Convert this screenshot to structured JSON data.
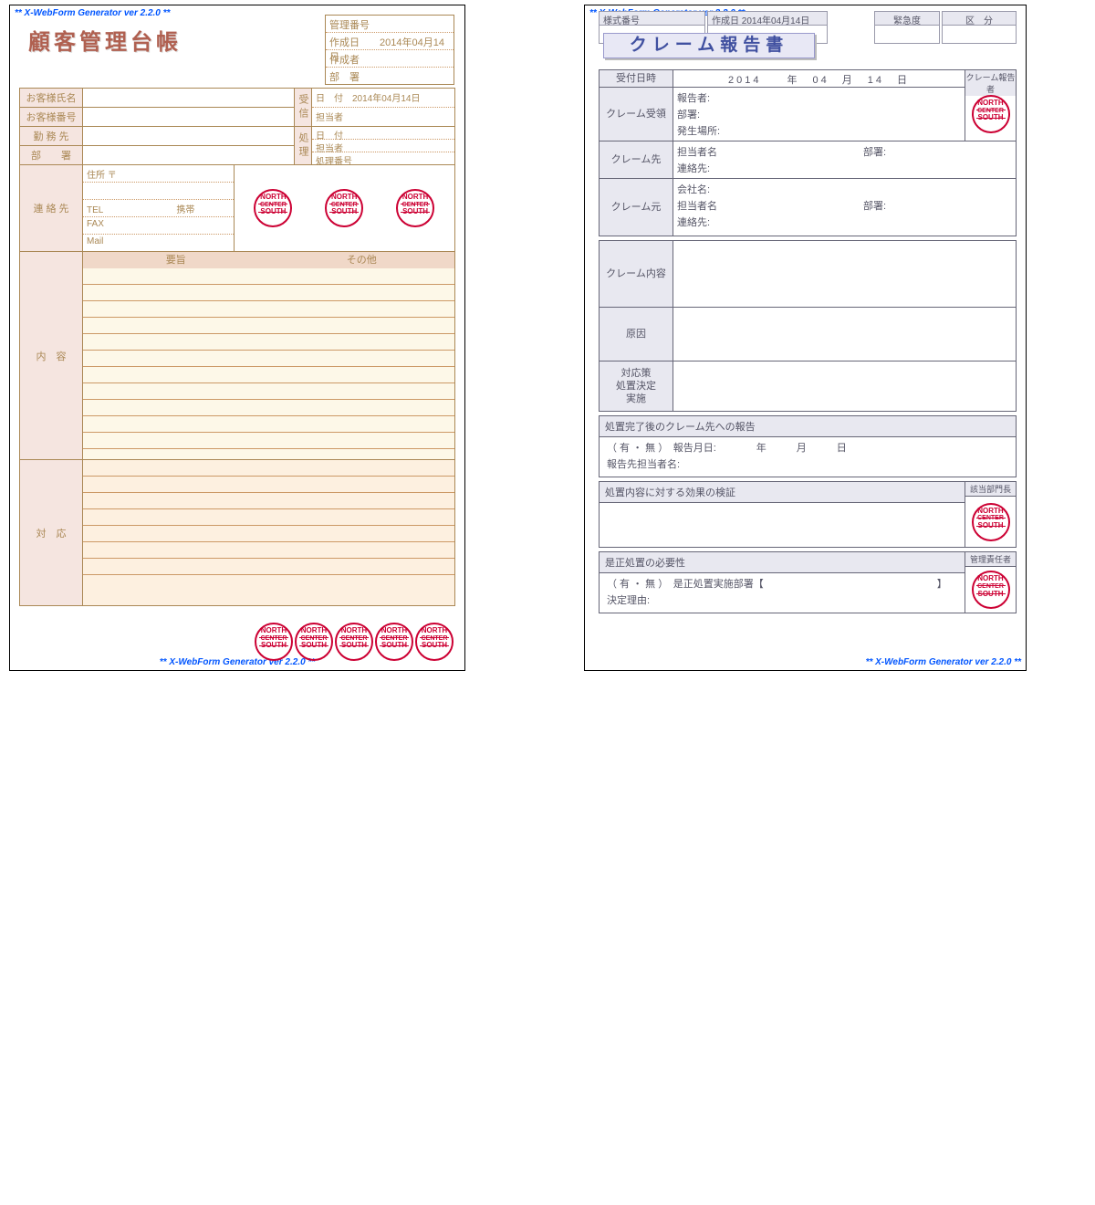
{
  "watermark": "** X-WebForm Generator ver 2.2.0 **",
  "stamp": {
    "top": "NORTH",
    "mid": "CENTER",
    "bot": "SOUTH"
  },
  "form1": {
    "title": "顧客管理台帳",
    "hdr": {
      "manage_no": "管理番号",
      "create_date_l": "作成日",
      "create_date_v": "2014年04月14日",
      "creator": "作成者",
      "dept": "部　署"
    },
    "left": {
      "customer_name": "お客様氏名",
      "customer_no": "お客様番号",
      "work": "勤 務 先",
      "dept": "部　　署",
      "contact": "連 絡 先",
      "address": "住所 〒",
      "tel": "TEL",
      "mobile": "携帯",
      "fax": "FAX",
      "mail": "Mail"
    },
    "right": {
      "receive": "受信",
      "date_l": "日　付",
      "date_v": "2014年04月14日",
      "person": "担当者",
      "process": "処理",
      "date2": "日　付",
      "person2": "担当者",
      "proc_no": "処理番号"
    },
    "content": "内　容",
    "summary": "要旨",
    "other": "その他",
    "response": "対　応"
  },
  "form2": {
    "title": "クレーム報告書",
    "hdr": {
      "form_no": "様式番号",
      "create_date_l": "作成日",
      "create_date_v": "2014年04月14日",
      "urgency": "緊急度",
      "category": "区　分"
    },
    "tbl1": {
      "date_l": "受付日時",
      "date_v": "2014　　年　04　月　14　日",
      "reporter_col": "クレーム報告者",
      "receive": "クレーム受領",
      "reporter": "報告者:",
      "dept_f": "部署:",
      "place": "発生場所:",
      "dest": "クレーム先",
      "person": "担当者名",
      "dept": "部署:",
      "contact": "連絡先:",
      "source": "クレーム元",
      "company": "会社名:"
    },
    "tbl2": {
      "content": "クレーム内容",
      "cause": "原因",
      "measure1": "対応策",
      "measure2": "処置決定",
      "measure3": "実施"
    },
    "report": {
      "hdr": "処置完了後のクレーム先への報告",
      "line1a": "（ 有 ・ 無 ）",
      "line1b": "報告月日:",
      "line1c": "年　　　月　　　日",
      "line2": "報告先担当者名:"
    },
    "verify": {
      "hdr": "処置内容に対する効果の検証",
      "col": "該当部門長"
    },
    "corrective": {
      "hdr": "是正処置の必要性",
      "col": "管理責任者",
      "line1a": "（ 有 ・ 無 ）",
      "line1b": "是正処置実施部署【",
      "line1c": "】",
      "line2": "決定理由:"
    }
  }
}
